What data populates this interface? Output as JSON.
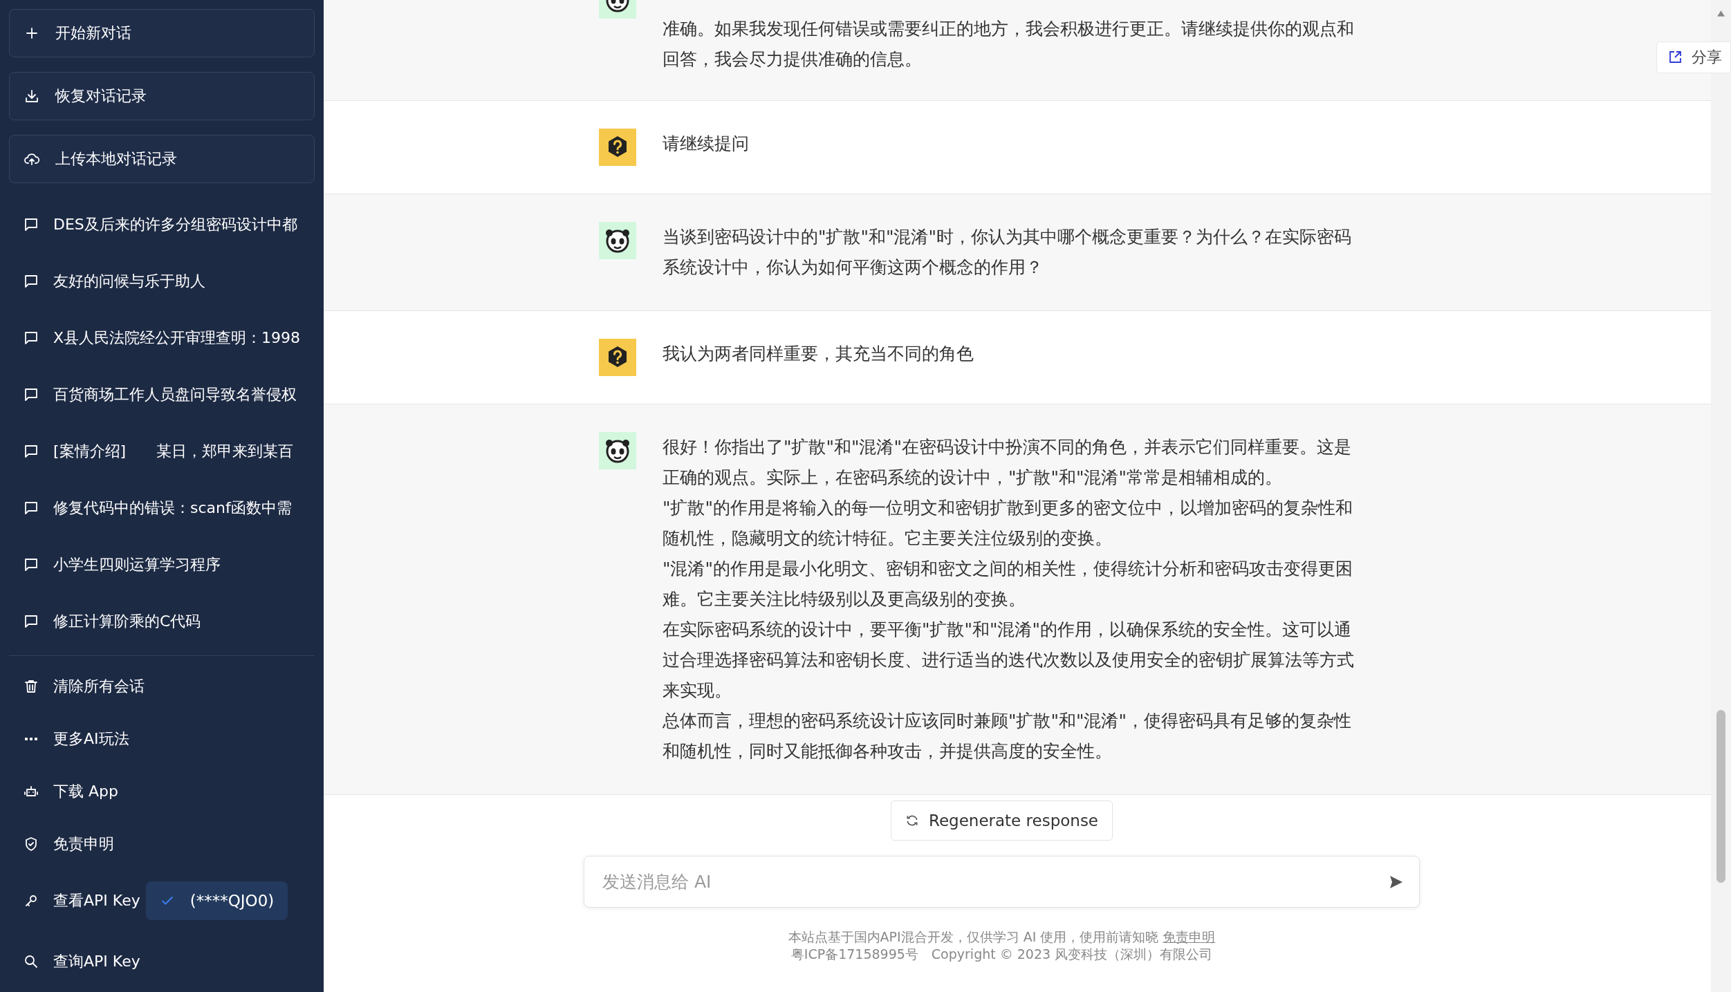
{
  "sidebar": {
    "top_buttons": [
      "开始新对话",
      "恢复对话记录",
      "上传本地对话记录"
    ],
    "conversations": [
      "DES及后来的许多分组密码设计中都",
      "友好的问候与乐于助人",
      "X县人民法院经公开审理查明：1998",
      "百货商场工作人员盘问导致名誉侵权",
      "[案情介绍]　　某日，郑甲来到某百",
      "修复代码中的错误：scanf函数中需",
      "小学生四则运算学习程序",
      "修正计算阶乘的C代码"
    ],
    "actions": [
      "清除所有会话",
      "更多AI玩法",
      "下载 App",
      "免责申明"
    ],
    "api_key": {
      "label": "查看API Key",
      "value": "(****QJO0)",
      "checked": true
    },
    "query_key": "查询API Key"
  },
  "share_button": "分享",
  "messages": [
    {
      "kind": "bot",
      "paragraphs": [
        "准确。如果我发现任何错误或需要纠正的地方，我会积极进行更正。请继续提供你的观点和回答，我会尽力提供准确的信息。"
      ]
    },
    {
      "kind": "user",
      "paragraphs": [
        "请继续提问"
      ]
    },
    {
      "kind": "bot",
      "paragraphs": [
        "当谈到密码设计中的\"扩散\"和\"混淆\"时，你认为其中哪个概念更重要？为什么？在实际密码系统设计中，你认为如何平衡这两个概念的作用？"
      ]
    },
    {
      "kind": "user",
      "paragraphs": [
        "我认为两者同样重要，其充当不同的角色"
      ]
    },
    {
      "kind": "bot",
      "paragraphs": [
        "很好！你指出了\"扩散\"和\"混淆\"在密码设计中扮演不同的角色，并表示它们同样重要。这是正确的观点。实际上，在密码系统的设计中，\"扩散\"和\"混淆\"常常是相辅相成的。",
        "\"扩散\"的作用是将输入的每一位明文和密钥扩散到更多的密文位中，以增加密码的复杂性和随机性，隐藏明文的统计特征。它主要关注位级别的变换。",
        "\"混淆\"的作用是最小化明文、密钥和密文之间的相关性，使得统计分析和密码攻击变得更困难。它主要关注比特级别以及更高级别的变换。",
        "在实际密码系统的设计中，要平衡\"扩散\"和\"混淆\"的作用，以确保系统的安全性。这可以通过合理选择密码算法和密钥长度、进行适当的迭代次数以及使用安全的密钥扩展算法等方式来实现。",
        "总体而言，理想的密码系统设计应该同时兼顾\"扩散\"和\"混淆\"，使得密码具有足够的复杂性和随机性，同时又能抵御各种攻击，并提供高度的安全性。"
      ]
    }
  ],
  "regenerate_button": "Regenerate response",
  "input": {
    "placeholder": "发送消息给 AI"
  },
  "footer": {
    "notice": "本站点基于国内API混合开发，仅供学习 AI 使用，使用前请知晓",
    "notice_link": "免责申明",
    "copyright": "粤ICP备17158995号　Copyright © 2023 风变科技（深圳）有限公司"
  }
}
